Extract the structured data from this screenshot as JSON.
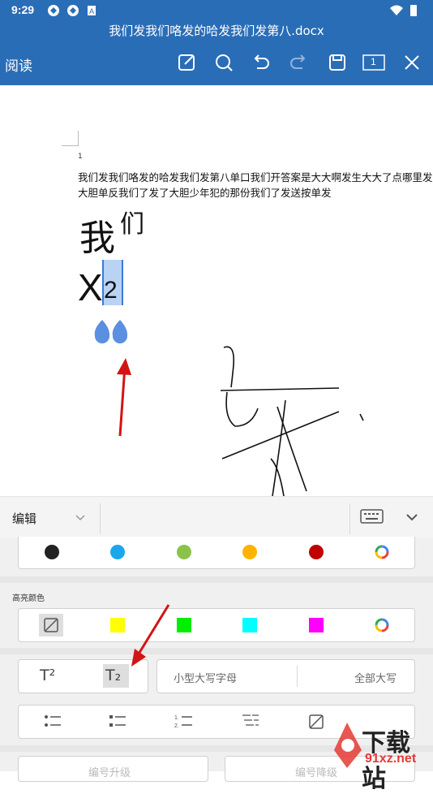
{
  "status_bar": {
    "time": "9:29"
  },
  "title_bar": {
    "title": "我们发我们咯发的哈发我们发第八.docx"
  },
  "toolbar": {
    "mode_label": "阅读",
    "page_count": "1"
  },
  "document": {
    "page_number": "1",
    "paragraph_line1": "我们发我们咯发的哈发我们发第八单口我们开答案是大大啊发生大大了点哪里发",
    "paragraph_line2": "大胆单反我们了发了大胆少年犯的那份我们了发送按单发",
    "big_text": "我",
    "superscript_text": "们",
    "x_text": "X",
    "subscript_text": "2"
  },
  "edit_bar": {
    "mode_label": "编辑"
  },
  "format_panel": {
    "font_colors": [
      "#222222",
      "#1aa7ec",
      "#8bc34a",
      "#ffb300",
      "#c00000"
    ],
    "highlight_label": "高亮颜色",
    "highlight_colors": [
      "#ffff00",
      "#00ee00",
      "#00ffff",
      "#ff00ff"
    ],
    "superscript_label": "T²",
    "subscript_label": "T₂",
    "small_caps_label": "小型大写字母",
    "all_caps_label": "全部大写",
    "bottom_left_label": "编号升级",
    "bottom_right_label": "编号降级"
  },
  "watermark": {
    "brand": "下载站",
    "domain": "91xz.net"
  }
}
